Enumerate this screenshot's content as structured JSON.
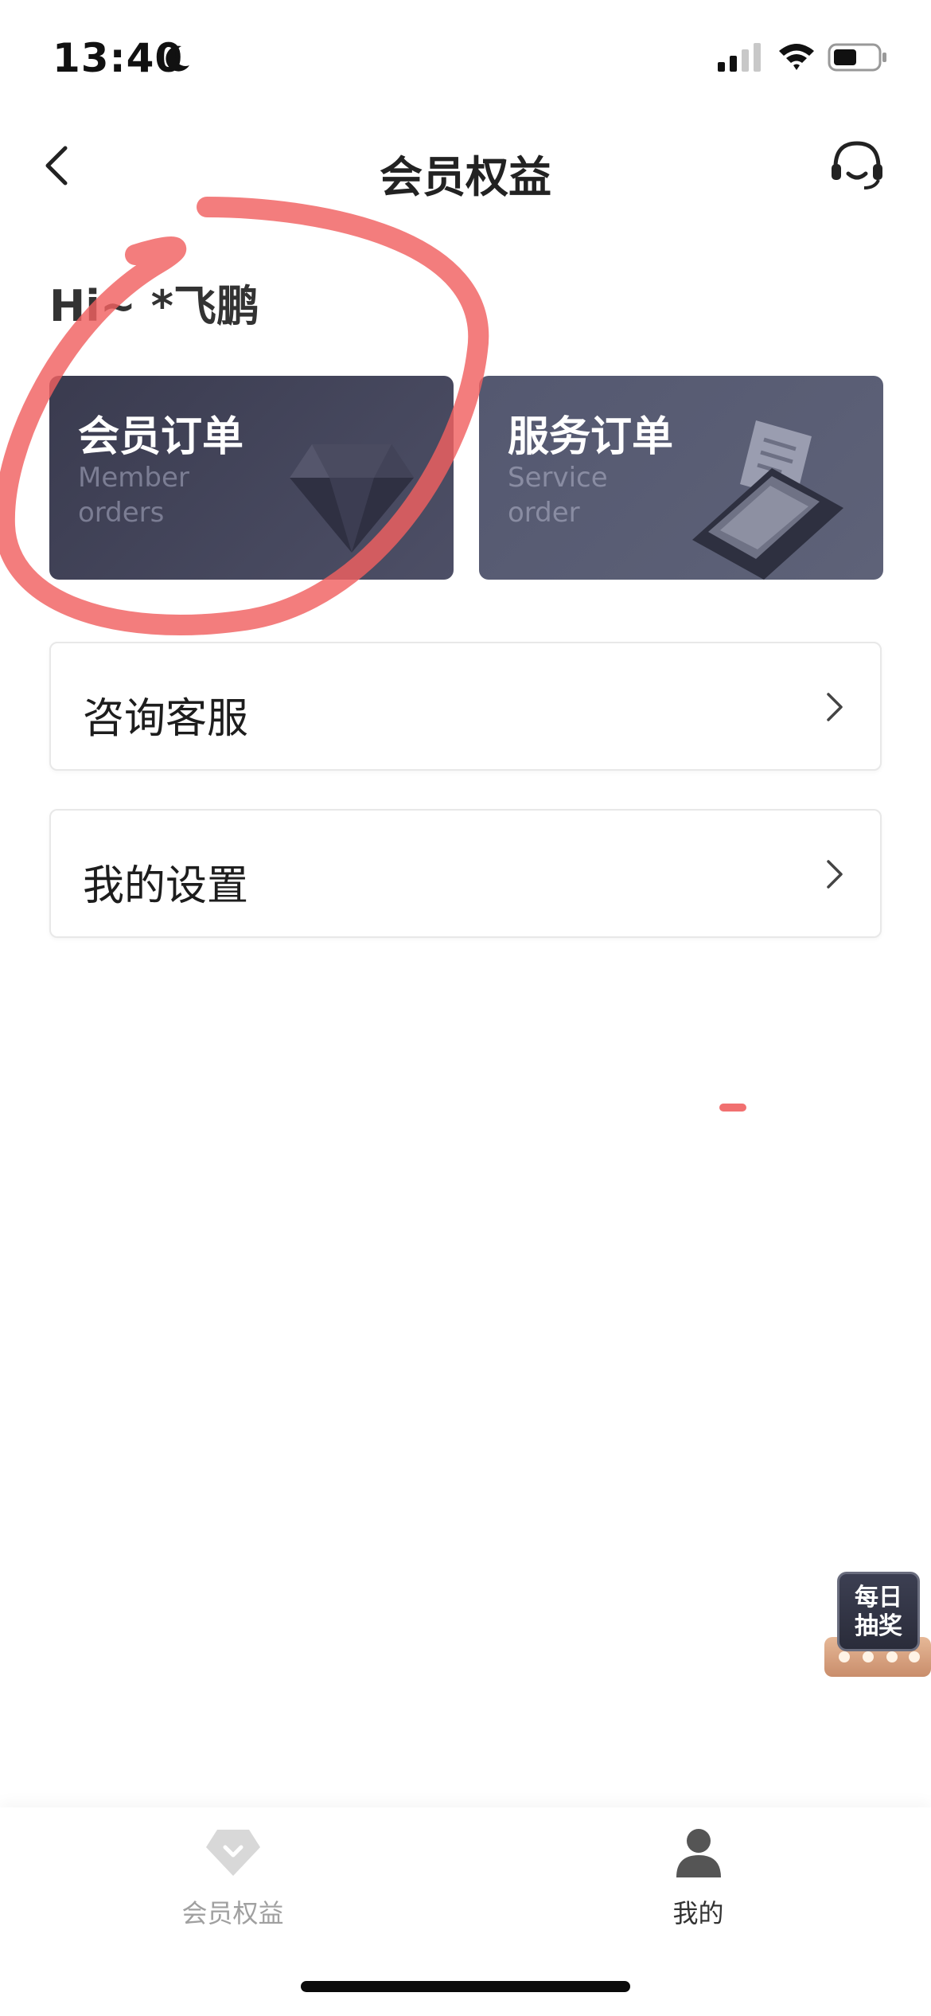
{
  "status_bar": {
    "time": "13:40"
  },
  "header": {
    "title": "会员权益"
  },
  "greeting": "Hi~ *飞鹏",
  "cards": [
    {
      "title": "会员订单",
      "subtitle": "Member orders",
      "icon": "diamond-icon"
    },
    {
      "title": "服务订单",
      "subtitle": "Service order",
      "icon": "card-machine-icon"
    }
  ],
  "list": [
    {
      "label": "咨询客服"
    },
    {
      "label": "我的设置"
    }
  ],
  "lottery": {
    "label": "每日抽奖"
  },
  "tabbar": {
    "items": [
      {
        "label": "会员权益",
        "icon": "diamond-icon",
        "active": false
      },
      {
        "label": "我的",
        "icon": "person-icon",
        "active": true
      }
    ]
  },
  "colors": {
    "accent_dark": "#3a3b4f",
    "annotation_red": "#f06060",
    "tab_inactive": "#a0a0a0"
  }
}
